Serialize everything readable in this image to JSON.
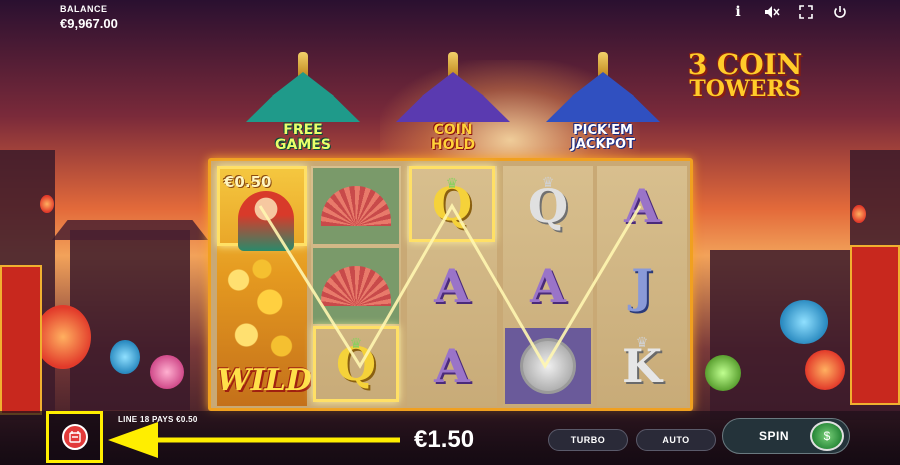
{
  "header": {
    "balance_label": "BALANCE",
    "balance_value": "€9,967.00",
    "icons": [
      "info-icon",
      "sound-muted-icon",
      "fullscreen-icon",
      "power-icon"
    ],
    "icon_glyphs": {
      "info": "i",
      "sound": "🔇",
      "fullscreen": "⛶",
      "power": "⏻"
    }
  },
  "logo": {
    "line1": "3 COIN",
    "line2": "TOWERS"
  },
  "towers": [
    {
      "line1": "FREE",
      "line2": "GAMES"
    },
    {
      "line1": "COIN",
      "line2": "HOLD"
    },
    {
      "line1": "PICK'EM",
      "line2": "JACKPOT"
    }
  ],
  "reels": {
    "wild_value": "€0.50",
    "wild_label": "WILD",
    "col2": [
      "fan",
      "fan",
      "Q"
    ],
    "col3": [
      "Q",
      "A",
      "A"
    ],
    "col4": [
      "Q",
      "A",
      "coin"
    ],
    "col5": [
      "A",
      "J",
      "K"
    ],
    "letters": {
      "Q": "Q",
      "A": "A",
      "J": "J",
      "K": "K"
    }
  },
  "footer": {
    "line_info": "LINE 18 PAYS €0.50",
    "win_amount": "€1.50",
    "turbo_label": "TURBO",
    "auto_label": "AUTO",
    "spin_label": "SPIN",
    "bet_icon_glyph": "🎰",
    "cash_icon_glyph": "$"
  },
  "colors": {
    "accent": "#ffee00",
    "frame": "#f0a020",
    "wild": "#ffe04a"
  }
}
